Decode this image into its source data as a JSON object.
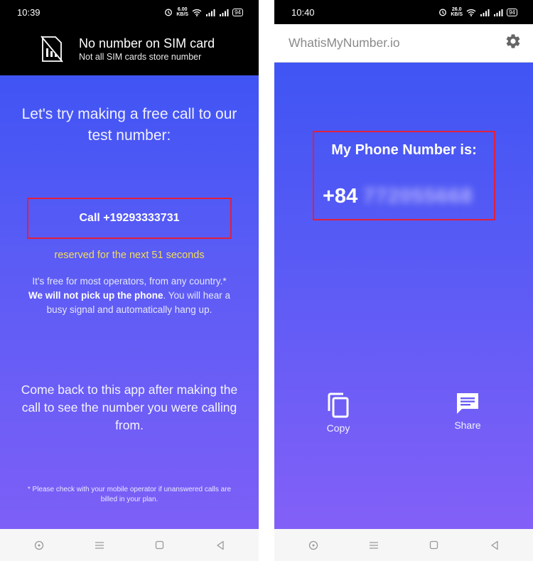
{
  "left": {
    "status": {
      "time": "10:39",
      "net_speed": "6.00",
      "net_unit": "KB/S",
      "battery": "94"
    },
    "sim_header": {
      "title": "No number on SIM card",
      "subtitle": "Not all SIM cards store number"
    },
    "try_text": "Let's try making a free call to our test number:",
    "call_button": "Call +19293333731",
    "reserved_text": "reserved for the next 51 seconds",
    "free_text_1": "It's free for most operators, from any country.*",
    "free_text_bold": "We will not pick up the phone",
    "free_text_2": ". You will hear a busy signal and automatically hang up.",
    "come_back": "Come back to this app after making the call to see the number you were calling from.",
    "footnote": "* Please check with your mobile operator if unanswered calls are billed in your plan."
  },
  "right": {
    "status": {
      "time": "10:40",
      "net_speed": "26.0",
      "net_unit": "KB/S",
      "battery": "94"
    },
    "app_title": "WhatisMyNumber.io",
    "number_label": "My Phone Number is:",
    "country_code": "+84",
    "hidden_number": "772055668",
    "copy_label": "Copy",
    "share_label": "Share"
  },
  "colors": {
    "accent_red": "#e0203c",
    "gradient_top": "#4054f4",
    "gradient_bottom": "#7d5ff6",
    "reserved_yellow": "#f3dd59"
  },
  "icons": [
    "sim-card-icon",
    "alarm-icon",
    "wifi-icon",
    "signal-icon",
    "gear-icon",
    "copy-icon",
    "share-icon",
    "home-circle-icon",
    "menu-icon",
    "square-icon",
    "back-icon"
  ]
}
